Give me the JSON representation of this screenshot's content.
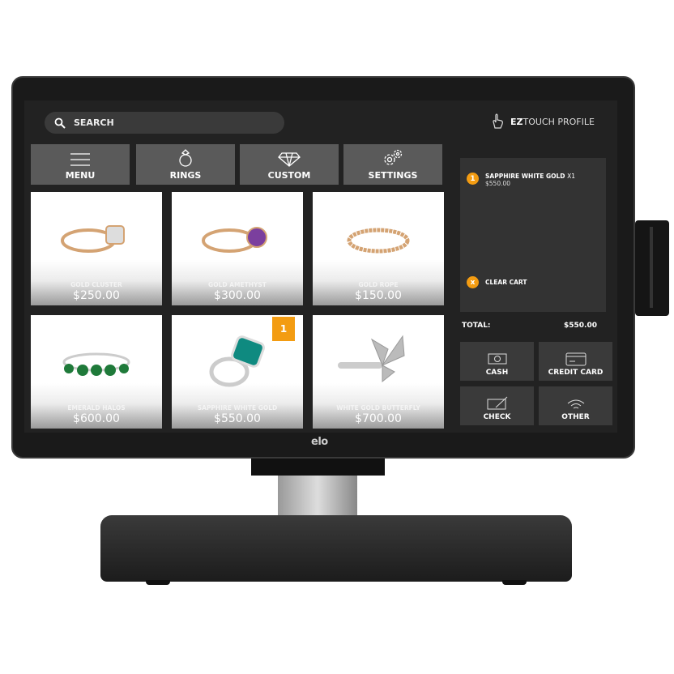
{
  "brand": "elo",
  "colors": {
    "accent": "#f39c12",
    "button": "#5a5a5a",
    "panel": "#333333"
  },
  "search": {
    "label": "SEARCH",
    "icon": "search-icon"
  },
  "profile": {
    "brand": "EZ",
    "label": "TOUCH PROFILE",
    "icon": "touch-hand-icon"
  },
  "nav": [
    {
      "label": "MENU",
      "icon": "hamburger-icon"
    },
    {
      "label": "RINGS",
      "icon": "ring-icon"
    },
    {
      "label": "CUSTOM",
      "icon": "diamond-icon"
    },
    {
      "label": "SETTINGS",
      "icon": "gears-icon"
    }
  ],
  "products": [
    {
      "name": "GOLD CLUSTER",
      "price": "$250.00"
    },
    {
      "name": "GOLD AMETHYST",
      "price": "$300.00"
    },
    {
      "name": "GOLD ROPE",
      "price": "$150.00"
    },
    {
      "name": "EMERALD HALOS",
      "price": "$600.00"
    },
    {
      "name": "SAPPHIRE WHITE GOLD",
      "price": "$550.00",
      "badge": "1"
    },
    {
      "name": "WHITE GOLD BUTTERFLY",
      "price": "$700.00"
    }
  ],
  "cart": {
    "items": [
      {
        "qty": "1",
        "name": "SAPPHIRE WHITE GOLD",
        "mult": "X1",
        "price": "$550.00"
      }
    ],
    "clear_label": "CLEAR CART",
    "clear_icon": "x"
  },
  "total": {
    "label": "TOTAL:",
    "value": "$550.00"
  },
  "payments": [
    {
      "label": "CASH",
      "icon": "cash-icon"
    },
    {
      "label": "CREDIT CARD",
      "icon": "credit-card-icon"
    },
    {
      "label": "CHECK",
      "icon": "check-icon"
    },
    {
      "label": "OTHER",
      "icon": "contactless-icon"
    }
  ]
}
